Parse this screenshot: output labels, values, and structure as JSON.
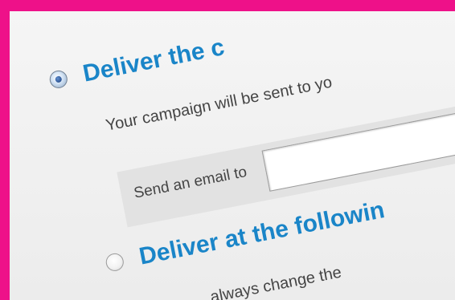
{
  "options": {
    "deliver_now": {
      "label": "Deliver the c",
      "selected": true,
      "description": "Your campaign will be sent to yo",
      "email_label": "Send an email to",
      "email_value": ""
    },
    "deliver_later": {
      "label": "Deliver at the followin",
      "selected": false,
      "description": "always change the"
    }
  },
  "colors": {
    "frame_border": "#ee1189",
    "heading": "#1a85c8",
    "panel": "#f0f0f0",
    "email_row": "#e2e2e2"
  }
}
